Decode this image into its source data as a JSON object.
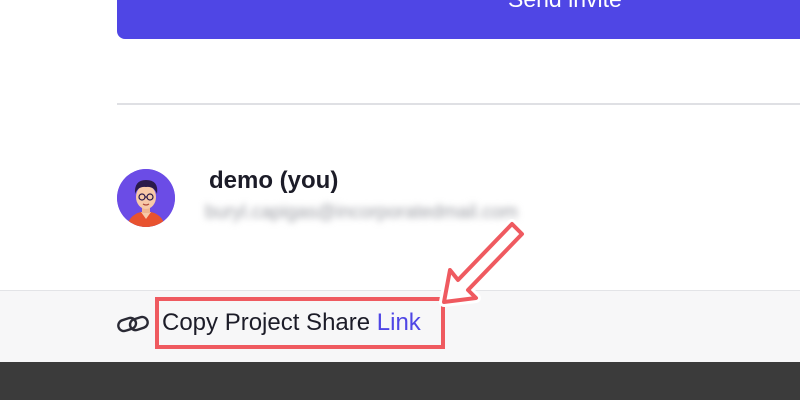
{
  "invite_form": {
    "send_label": "Send invite"
  },
  "member": {
    "name": "demo (you)",
    "email": "buryl.capigas@incorporatedmail.com",
    "avatar_icon": "user-avatar-icon"
  },
  "footer": {
    "copy_link_part_a": "Copy Project Share ",
    "copy_link_part_b": "Link",
    "link_icon": "link-chain-icon"
  },
  "annotation": {
    "highlight_color": "#ef5a60",
    "arrow_icon": "arrow-pointer-icon"
  },
  "colors": {
    "accent": "#4f46e5",
    "text": "#1c1c28",
    "muted": "#9a9ca3"
  }
}
